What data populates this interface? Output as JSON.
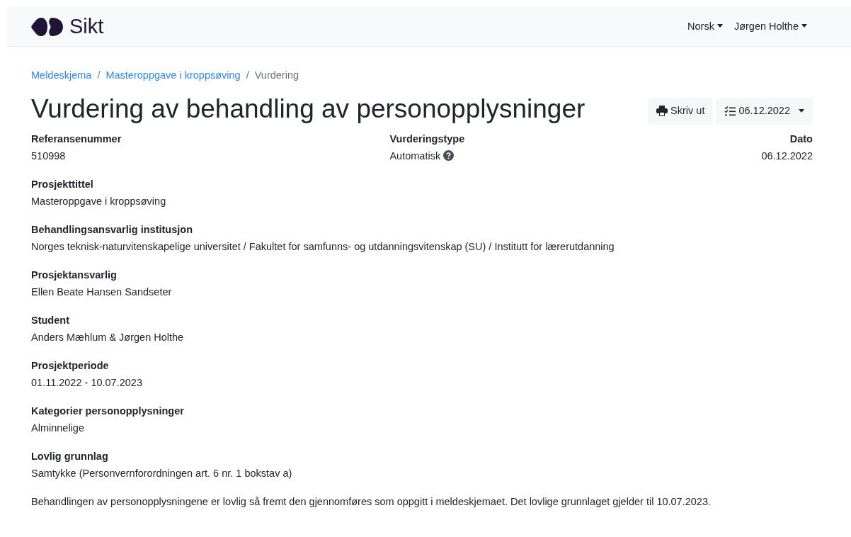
{
  "navbar": {
    "brand": "Sikt",
    "menus": [
      {
        "label": "Norsk"
      },
      {
        "label": "Jørgen Holthe"
      }
    ]
  },
  "breadcrumb_separator": "/",
  "breadcrumb": [
    {
      "label": "Meldeskjema",
      "current": false
    },
    {
      "label": "Masteroppgave i kroppsøving",
      "current": false
    },
    {
      "label": "Vurdering",
      "current": true
    }
  ],
  "title": "Vurdering av behandling av personopplysninger",
  "actions": {
    "print": "Skriv ut",
    "version": "06.12.2022"
  },
  "summary": [
    {
      "label": "Referansenummer",
      "value": "510998",
      "help": false
    },
    {
      "label": "Vurderingstype",
      "value": "Automatisk",
      "help": true
    },
    {
      "label": "Dato",
      "value": "06.12.2022",
      "help": false
    }
  ],
  "fields": [
    {
      "label": "Prosjekttittel",
      "value": "Masteroppgave i kroppsøving"
    },
    {
      "label": "Behandlingsansvarlig institusjon",
      "value": "Norges teknisk-naturvitenskapelige universitet / Fakultet for samfunns- og utdanningsvitenskap (SU) / Institutt for lærerutdanning"
    },
    {
      "label": "Prosjektansvarlig",
      "value": "Ellen Beate Hansen Sandseter"
    },
    {
      "label": "Student",
      "value": "Anders Mæhlum & Jørgen Holthe"
    },
    {
      "label": "Prosjektperiode",
      "value": "01.11.2022 - 10.07.2023"
    },
    {
      "label": "Kategorier personopplysninger",
      "value": "Alminnelige"
    },
    {
      "label": "Lovlig grunnlag",
      "value": "Samtykke (Personvernforordningen art. 6 nr. 1 bokstav a)"
    }
  ],
  "note": "Behandlingen av personopplysningene er lovlig så fremt den gjennomføres som oppgitt i meldeskjemaet. Det lovlige grunnlaget gjelder til 10.07.2023."
}
